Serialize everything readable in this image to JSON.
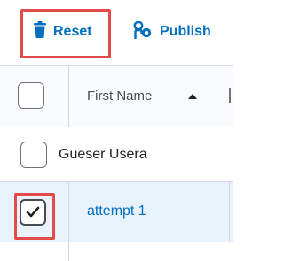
{
  "toolbar": {
    "reset_label": "Reset",
    "reset_icon": "trash-icon",
    "publish_label": "Publish",
    "publish_icon": "people-icon",
    "link_color": "#006fbf"
  },
  "table": {
    "header": {
      "first_name": "First Name",
      "sort_icon": "sort-ascending-icon",
      "select_all_checked": false
    },
    "rows": [
      {
        "name": "Gueser Usera",
        "checked": false,
        "is_link": false
      },
      {
        "name": "attempt 1",
        "checked": true,
        "is_link": true
      }
    ],
    "selected_row_color": "#e8f2fb"
  },
  "annotations": {
    "highlight_color": "#e34a4a"
  }
}
